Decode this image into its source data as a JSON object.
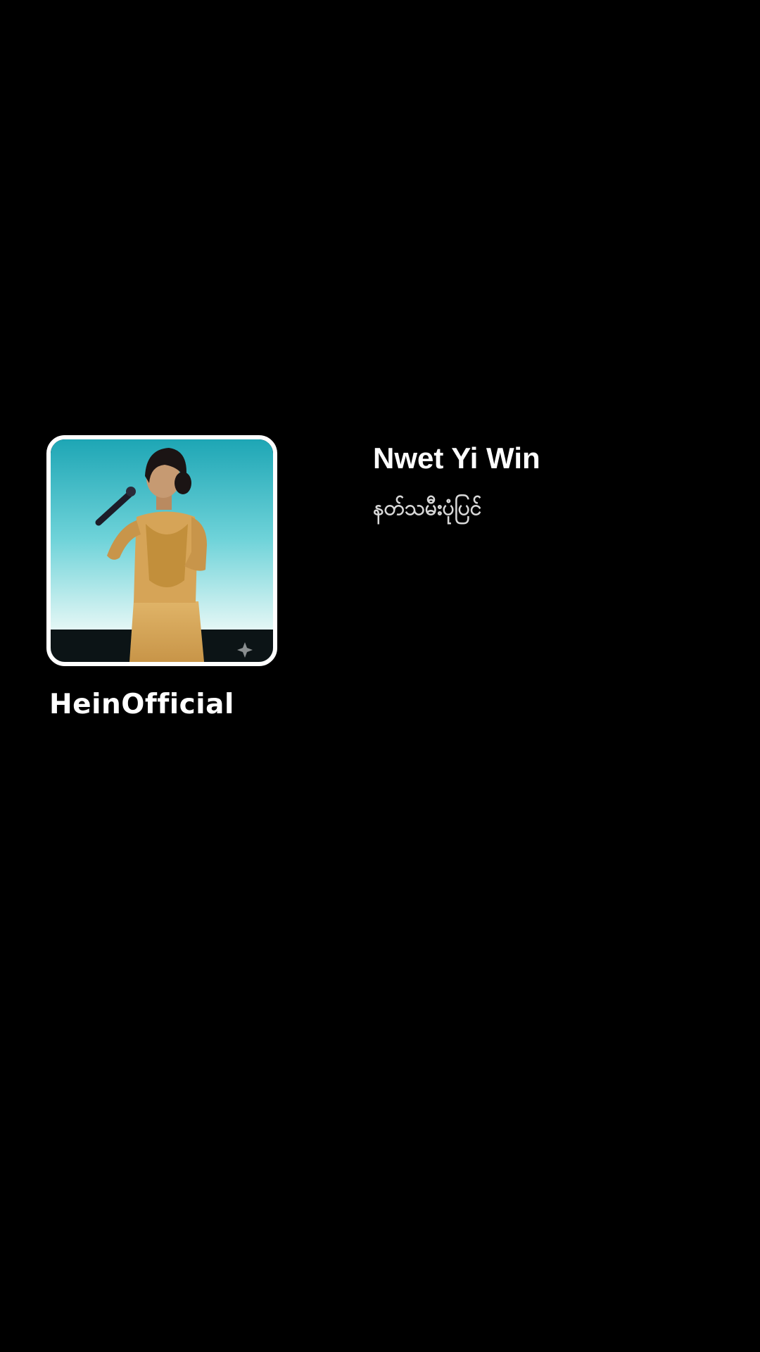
{
  "track": {
    "title": "Nwet Yi Win",
    "subtitle": "နတ်သမီးပုံပြင်"
  },
  "channel": {
    "name": "HeinOfficial"
  },
  "cover": {
    "icon": "singer-performance-thumbnail",
    "colors": {
      "backdrop_top": "#2fb6c4",
      "backdrop_bottom": "#cfeff0",
      "dress": "#d9a85a",
      "frame": "#ffffff",
      "page_background": "#000000"
    }
  }
}
